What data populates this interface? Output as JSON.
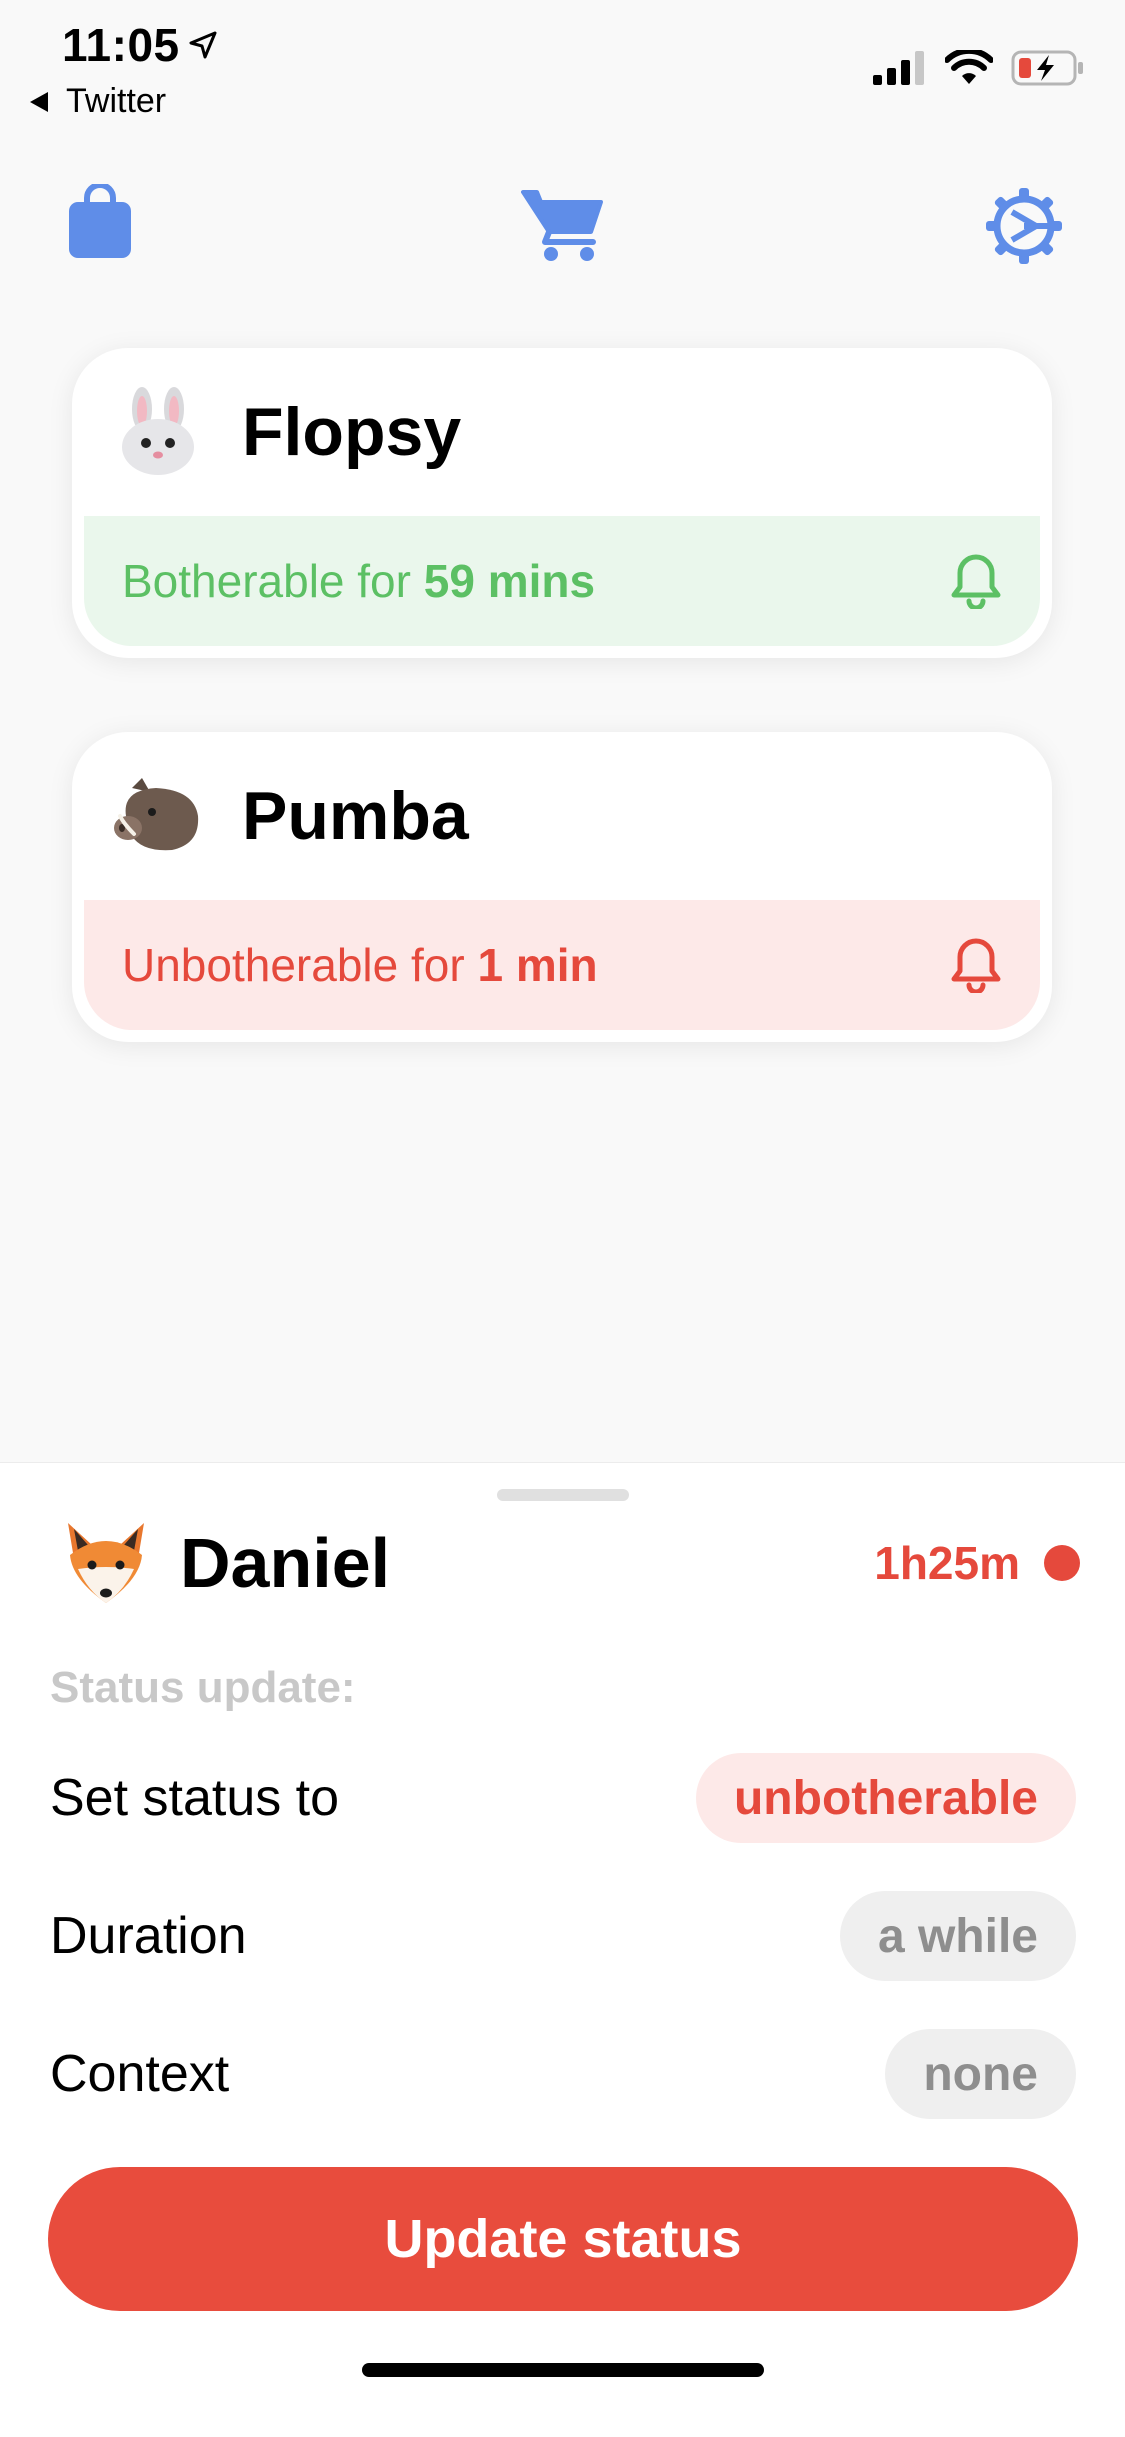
{
  "status_bar": {
    "time": "11:05",
    "back_app": "Twitter"
  },
  "toolbar": {
    "bag_icon": "shopping-bag-icon",
    "cart_icon": "cart-icon",
    "settings_icon": "gear-icon",
    "accent_color": "#5f8de8"
  },
  "contacts": [
    {
      "name": "Flopsy",
      "emoji": "rabbit",
      "status_prefix": "Botherable for ",
      "status_duration": "59 mins",
      "status_color": "#5cc064"
    },
    {
      "name": "Pumba",
      "emoji": "boar",
      "status_prefix": "Unbotherable for ",
      "status_duration": "1 min",
      "status_color": "#e5493c"
    }
  ],
  "sheet": {
    "user_name": "Daniel",
    "user_emoji": "fox",
    "timer": "1h25m",
    "section_label": "Status update:",
    "rows": [
      {
        "label": "Set status to",
        "value": "unbotherable"
      },
      {
        "label": "Duration",
        "value": "a while"
      },
      {
        "label": "Context",
        "value": "none"
      }
    ],
    "cta": "Update status"
  }
}
